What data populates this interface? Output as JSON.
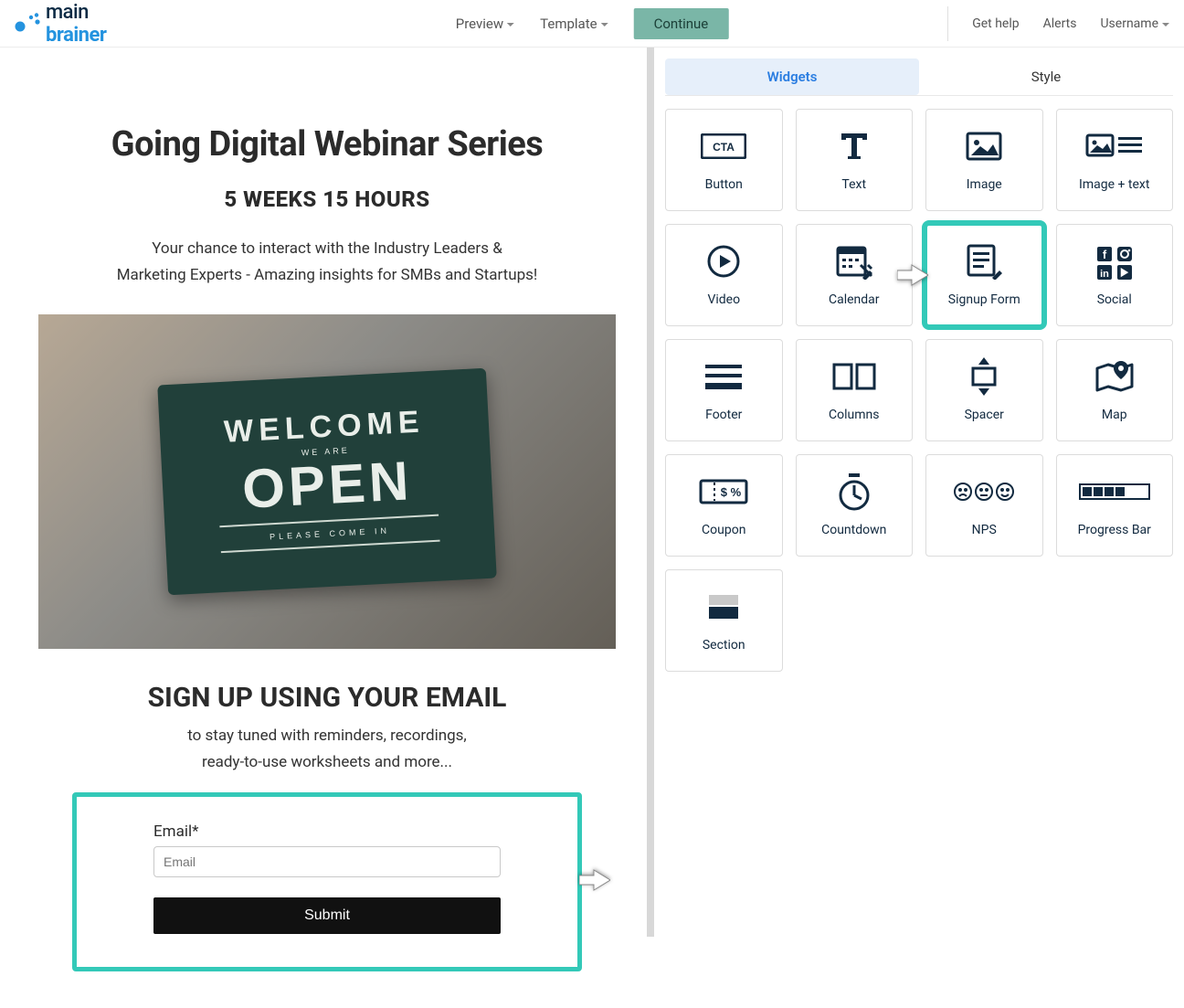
{
  "header": {
    "brand_main": "main",
    "brand_brain": "brainer",
    "preview": "Preview",
    "template": "Template",
    "continue": "Continue",
    "get_help": "Get help",
    "alerts": "Alerts",
    "username": "Username"
  },
  "canvas": {
    "title": "Going Digital Webinar Series",
    "subtitle": "5 WEEKS 15 HOURS",
    "lead_line1": "Your chance to interact with the Industry Leaders &",
    "lead_line2": "Marketing Experts - Amazing insights for SMBs and Startups!",
    "sign": {
      "welcome": "WELCOME",
      "we_are": "WE ARE",
      "open": "OPEN",
      "please": "PLEASE COME IN"
    },
    "signup_heading": "SIGN UP USING YOUR EMAIL",
    "signup_sub_line1": "to stay tuned with reminders, recordings,",
    "signup_sub_line2": "ready-to-use worksheets and more...",
    "form": {
      "email_label": "Email*",
      "email_placeholder": "Email",
      "submit": "Submit"
    }
  },
  "panel": {
    "tabs": {
      "widgets": "Widgets",
      "style": "Style"
    },
    "widgets": {
      "button": "Button",
      "text": "Text",
      "image": "Image",
      "image_text": "Image + text",
      "video": "Video",
      "calendar": "Calendar",
      "signup_form": "Signup Form",
      "social": "Social",
      "footer": "Footer",
      "columns": "Columns",
      "spacer": "Spacer",
      "map": "Map",
      "coupon": "Coupon",
      "countdown": "Countdown",
      "nps": "NPS",
      "progress_bar": "Progress Bar",
      "section": "Section"
    }
  },
  "colors": {
    "teal_highlight": "#33c9b8",
    "link_blue": "#2a7de1"
  }
}
